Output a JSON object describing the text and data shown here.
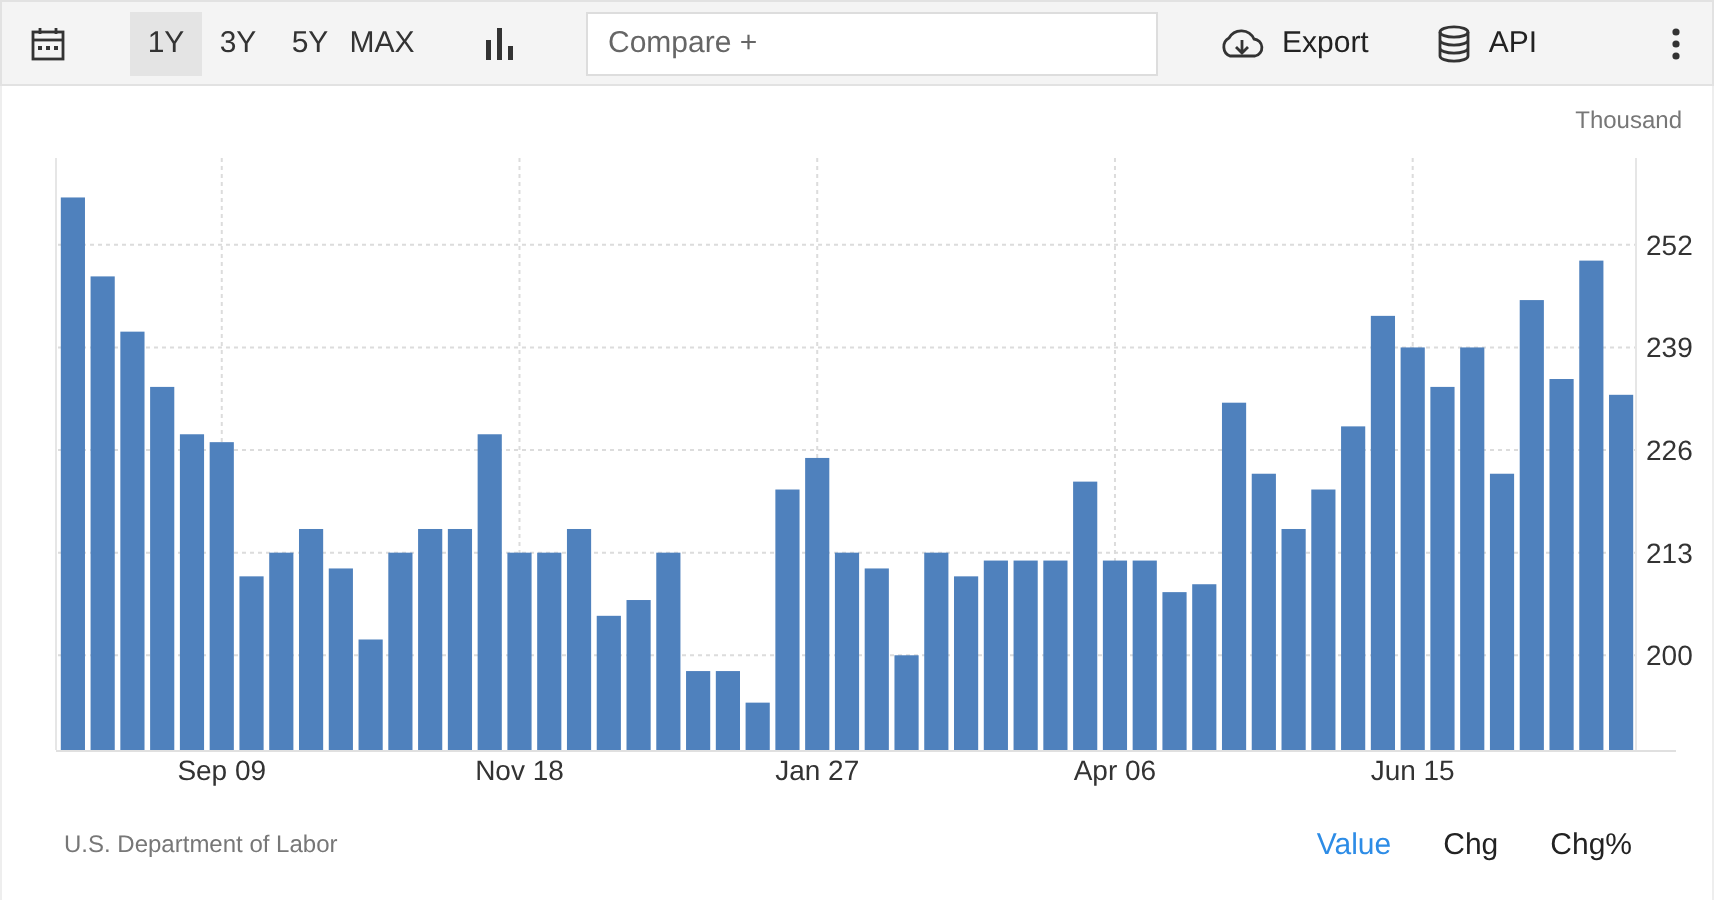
{
  "toolbar": {
    "ranges": [
      {
        "label": "1Y",
        "selected": true
      },
      {
        "label": "3Y",
        "selected": false
      },
      {
        "label": "5Y",
        "selected": false
      },
      {
        "label": "MAX",
        "selected": false
      }
    ],
    "compare": {
      "placeholder": "Compare +"
    },
    "actions": [
      {
        "kind": "export",
        "label": "Export"
      },
      {
        "kind": "api",
        "label": "API"
      }
    ]
  },
  "chart": {
    "unit": "Thousand",
    "chart_data": {
      "type": "bar",
      "categories": [
        null,
        null,
        null,
        null,
        null,
        "Sep 09",
        null,
        null,
        null,
        null,
        null,
        null,
        null,
        null,
        null,
        "Nov 18",
        null,
        null,
        null,
        null,
        null,
        null,
        null,
        null,
        null,
        "Jan 27",
        null,
        null,
        null,
        null,
        null,
        null,
        null,
        null,
        null,
        "Apr 06",
        null,
        null,
        null,
        null,
        null,
        null,
        null,
        null,
        null,
        "Jun 15",
        null,
        null,
        null,
        null,
        null,
        null,
        null
      ],
      "series": [
        {
          "color": "#4f81bd",
          "values": [
            258,
            248,
            241,
            234,
            228,
            227,
            210,
            213,
            216,
            211,
            202,
            213,
            216,
            216,
            228,
            213,
            213,
            216,
            205,
            207,
            213,
            198,
            198,
            194,
            221,
            225,
            213,
            211,
            200,
            213,
            210,
            212,
            212,
            212,
            222,
            212,
            212,
            208,
            209,
            232,
            223,
            216,
            221,
            229,
            243,
            239,
            234,
            239,
            223,
            245,
            235,
            250,
            233
          ]
        }
      ],
      "ylim": [
        188,
        263
      ],
      "grid": true,
      "yticks": [
        200,
        213,
        226,
        239,
        252
      ]
    }
  },
  "footer": {
    "source": "U.S. Department of Labor",
    "modes": [
      {
        "label": "Value",
        "selected": true
      },
      {
        "label": "Chg",
        "selected": false
      },
      {
        "label": "Chg%",
        "selected": false
      }
    ]
  }
}
